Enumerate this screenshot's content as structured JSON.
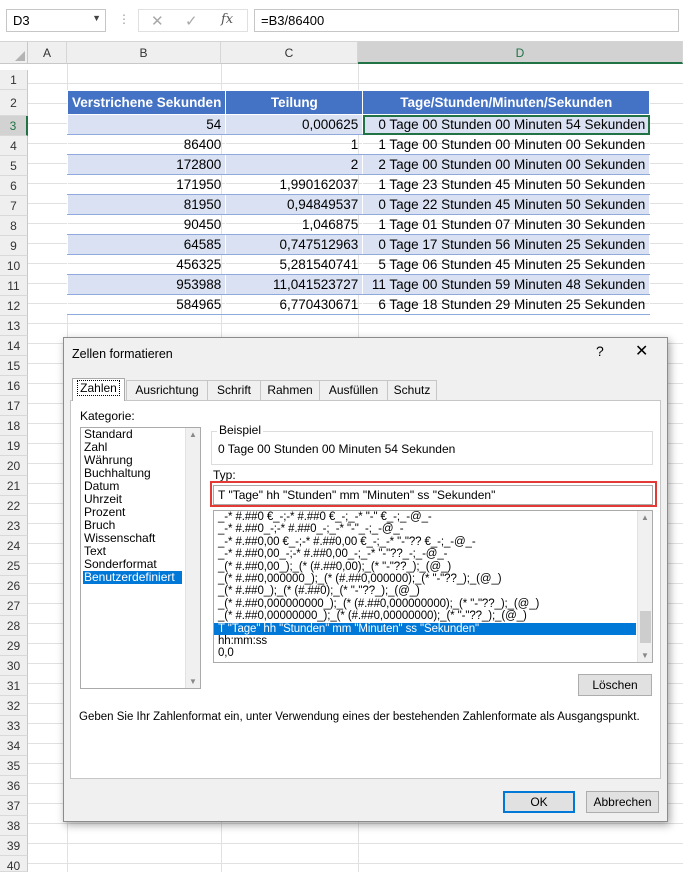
{
  "formula_bar": {
    "name_box": "D3",
    "cancel_icon": "✕",
    "enter_icon": "✓",
    "function_icon": "fx",
    "formula": "=B3/86400"
  },
  "columns": [
    "A",
    "B",
    "C",
    "D"
  ],
  "rows": [
    "1",
    "2",
    "3",
    "4",
    "5",
    "6",
    "7",
    "8",
    "9",
    "10",
    "11",
    "12",
    "13",
    "14",
    "15",
    "16",
    "17",
    "18",
    "19",
    "20",
    "21",
    "22",
    "23",
    "24",
    "25",
    "26",
    "27",
    "28",
    "29",
    "30",
    "31",
    "32",
    "33",
    "34",
    "35",
    "36",
    "37",
    "38",
    "39",
    "40",
    "41"
  ],
  "table": {
    "headers": [
      "Verstrichene Sekunden",
      "Teilung",
      "Tage/Stunden/Minuten/Sekunden"
    ],
    "rows": [
      [
        "54",
        "0,000625",
        "0 Tage 00 Stunden 00 Minuten 54 Sekunden"
      ],
      [
        "86400",
        "1",
        "1 Tage 00 Stunden 00 Minuten 00 Sekunden"
      ],
      [
        "172800",
        "2",
        "2 Tage 00 Stunden 00 Minuten 00 Sekunden"
      ],
      [
        "171950",
        "1,990162037",
        "1 Tage 23 Stunden 45 Minuten 50 Sekunden"
      ],
      [
        "81950",
        "0,94849537",
        "0 Tage 22 Stunden 45 Minuten 50 Sekunden"
      ],
      [
        "90450",
        "1,046875",
        "1 Tage 01 Stunden 07 Minuten 30 Sekunden"
      ],
      [
        "64585",
        "0,747512963",
        "0 Tage 17 Stunden 56 Minuten 25 Sekunden"
      ],
      [
        "456325",
        "5,281540741",
        "5 Tage 06 Stunden 45 Minuten 25 Sekunden"
      ],
      [
        "953988",
        "11,041523727",
        "11 Tage 00 Stunden 59 Minuten 48 Sekunden"
      ],
      [
        "584965",
        "6,770430671",
        "6 Tage 18 Stunden 29 Minuten 25 Sekunden"
      ]
    ]
  },
  "dialog": {
    "title": "Zellen formatieren",
    "help": "?",
    "close": "✕",
    "tabs": [
      "Zahlen",
      "Ausrichtung",
      "Schrift",
      "Rahmen",
      "Ausfüllen",
      "Schutz"
    ],
    "kategorie_label": "Kategorie:",
    "categories": [
      "Standard",
      "Zahl",
      "Währung",
      "Buchhaltung",
      "Datum",
      "Uhrzeit",
      "Prozent",
      "Bruch",
      "Wissenschaft",
      "Text",
      "Sonderformat",
      "Benutzerdefiniert"
    ],
    "beispiel_label": "Beispiel",
    "beispiel_value": "0 Tage 00 Stunden 00 Minuten 54 Sekunden",
    "typ_label": "Typ:",
    "typ_value": "T \"Tage\" hh \"Stunden\" mm \"Minuten\" ss \"Sekunden\"",
    "formats": [
      "_-* #.##0 €_-;-* #.##0 €_-;_-* \"-\" €_-;_-@_-",
      "_-* #.##0_-;-* #.##0_-;_-* \"-\"_-;_-@_-",
      "_-* #.##0,00 €_-;-* #.##0,00 €_-;_-* \"-\"?? €_-;_-@_-",
      "_-* #.##0,00_-;-* #.##0,00_-;_-* \"-\"??_-;_-@_-",
      "_(* #.##0,00_);_(* (#.##0,00);_(* \"-\"??_);_(@_)",
      "_(* #.##0,000000_);_(* (#.##0,000000);_(* \"-\"??_);_(@_)",
      "_(* #.##0_);_(* (#.##0);_(* \"-\"??_);_(@_)",
      "_(* #.##0,000000000_);_(* (#.##0,000000000);_(* \"-\"??_);_(@_)",
      "_(* #.##0,00000000_);_(* (#.##0,00000000);_(* \"-\"??_);_(@_)",
      "T \"Tage\" hh \"Stunden\" mm \"Minuten\" ss \"Sekunden\"",
      "hh:mm:ss",
      "0,0"
    ],
    "delete_button": "Löschen",
    "description": "Geben Sie Ihr Zahlenformat ein, unter Verwendung eines der bestehenden Zahlenformate als Ausgangspunkt.",
    "ok_button": "OK",
    "cancel_button": "Abbrechen"
  },
  "colors": {
    "header_blue": "#4472c4",
    "band_blue": "#d9e1f2",
    "selection_green": "#217346",
    "highlight_red": "#e53935",
    "list_selection": "#0078d7"
  }
}
